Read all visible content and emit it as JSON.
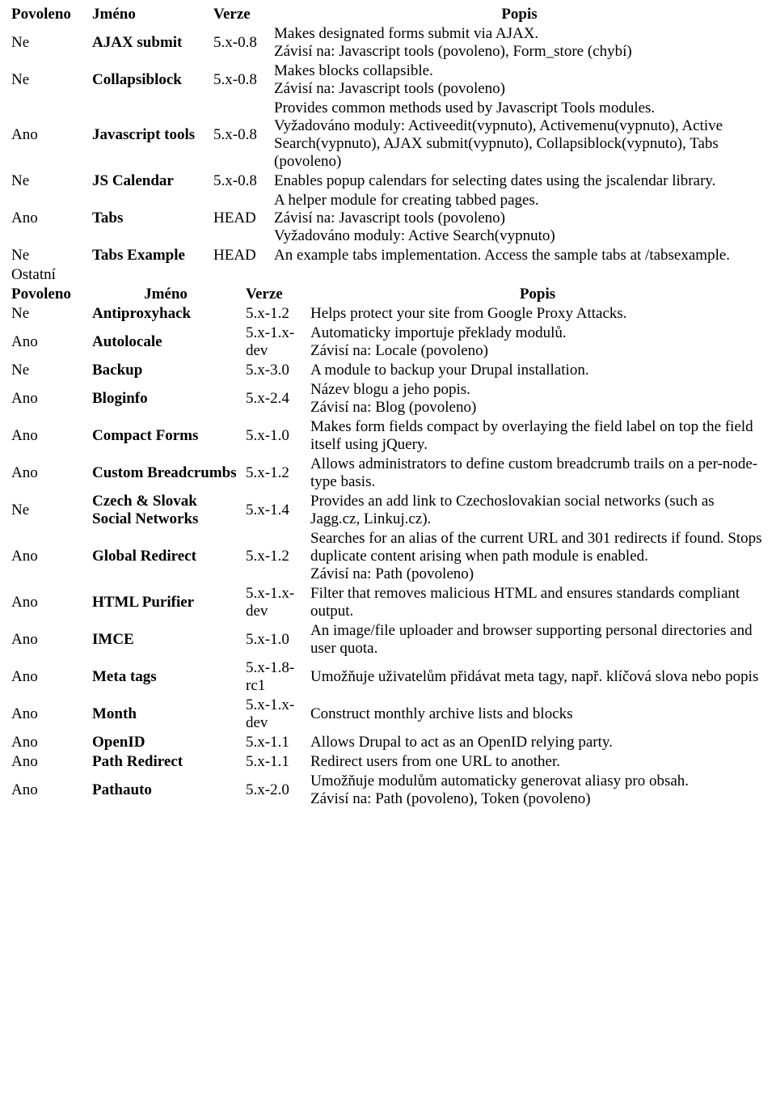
{
  "headers": {
    "enabled": "Povoleno",
    "name": "Jméno",
    "version": "Verze",
    "desc": "Popis"
  },
  "section2_label": "Ostatní",
  "table1": {
    "rows": [
      {
        "enabled": "Ne",
        "name": "AJAX submit",
        "version": "5.x-0.8",
        "desc": "Makes designated forms submit via AJAX.\nZávisí na: Javascript tools (povoleno), Form_store (chybí)"
      },
      {
        "enabled": "Ne",
        "name": "Collapsiblock",
        "version": "5.x-0.8",
        "desc": "Makes blocks collapsible.\nZávisí na: Javascript tools (povoleno)"
      },
      {
        "enabled": "Ano",
        "name": "Javascript tools",
        "version": "5.x-0.8",
        "desc": "Provides common methods used by Javascript Tools modules.\nVyžadováno moduly: Activeedit(vypnuto), Activemenu(vypnuto), Active Search(vypnuto), AJAX submit(vypnuto), Collapsiblock(vypnuto), Tabs (povoleno)"
      },
      {
        "enabled": "Ne",
        "name": "JS Calendar",
        "version": "5.x-0.8",
        "desc": "Enables popup calendars for selecting dates using the jscalendar library."
      },
      {
        "enabled": "Ano",
        "name": "Tabs",
        "version": "HEAD",
        "desc": "A helper module for creating tabbed pages.\nZávisí na: Javascript tools (povoleno)\nVyžadováno moduly: Active Search(vypnuto)"
      },
      {
        "enabled": "Ne",
        "name": "Tabs Example",
        "version": "HEAD",
        "desc": "An example tabs implementation. Access the sample tabs at /tabsexample."
      }
    ]
  },
  "table2": {
    "rows": [
      {
        "enabled": "Ne",
        "name": "Antiproxyhack",
        "version": "5.x-1.2",
        "desc": "Helps protect your site from Google Proxy Attacks."
      },
      {
        "enabled": "Ano",
        "name": "Autolocale",
        "version": "5.x-1.x-dev",
        "desc": "Automaticky importuje překlady modulů.\nZávisí na: Locale (povoleno)"
      },
      {
        "enabled": "Ne",
        "name": "Backup",
        "version": "5.x-3.0",
        "desc": "A module to backup your Drupal installation."
      },
      {
        "enabled": "Ano",
        "name": "Bloginfo",
        "version": "5.x-2.4",
        "desc": "Název blogu a jeho popis.\nZávisí na: Blog (povoleno)"
      },
      {
        "enabled": "Ano",
        "name": "Compact Forms",
        "version": "5.x-1.0",
        "desc": "Makes form fields compact by overlaying the field label on top the field itself using jQuery."
      },
      {
        "enabled": "Ano",
        "name": "Custom Breadcrumbs",
        "version": "5.x-1.2",
        "desc": "Allows administrators to define custom breadcrumb trails on a per-node-type basis."
      },
      {
        "enabled": "Ne",
        "name": "Czech & Slovak Social Networks",
        "version": "5.x-1.4",
        "desc": "Provides an add link to Czechoslovakian social networks (such as Jagg.cz, Linkuj.cz)."
      },
      {
        "enabled": "Ano",
        "name": "Global Redirect",
        "version": "5.x-1.2",
        "desc": "Searches for an alias of the current URL and 301 redirects if found. Stops duplicate content arising when path module is enabled.\nZávisí na: Path (povoleno)"
      },
      {
        "enabled": "Ano",
        "name": "HTML Purifier",
        "version": "5.x-1.x-dev",
        "desc": "Filter that removes malicious HTML and ensures standards compliant output."
      },
      {
        "enabled": "Ano",
        "name": "IMCE",
        "version": "5.x-1.0",
        "desc": "An image/file uploader and browser supporting personal directories and user quota."
      },
      {
        "enabled": "Ano",
        "name": "Meta tags",
        "version": "5.x-1.8-rc1",
        "desc": "Umožňuje uživatelům přidávat meta tagy, např. klíčová slova nebo popis"
      },
      {
        "enabled": "Ano",
        "name": "Month",
        "version": "5.x-1.x-dev",
        "desc": "Construct monthly archive lists and blocks"
      },
      {
        "enabled": "Ano",
        "name": "OpenID",
        "version": "5.x-1.1",
        "desc": "Allows Drupal to act as an OpenID relying party."
      },
      {
        "enabled": "Ano",
        "name": "Path Redirect",
        "version": "5.x-1.1",
        "desc": "Redirect users from one URL to another."
      },
      {
        "enabled": "Ano",
        "name": "Pathauto",
        "version": "5.x-2.0",
        "desc": "Umožňuje modulům automaticky generovat aliasy pro obsah.\nZávisí na: Path (povoleno), Token (povoleno)"
      }
    ]
  }
}
